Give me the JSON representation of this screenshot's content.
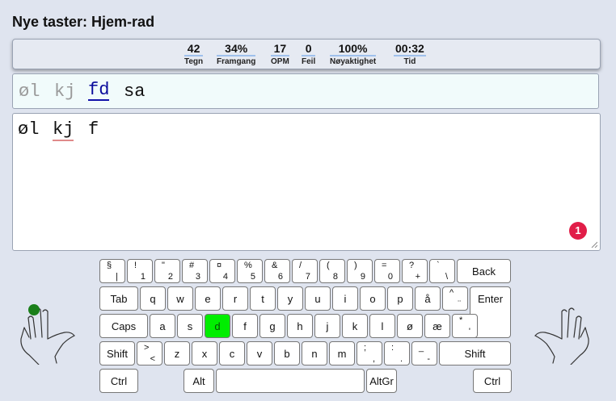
{
  "title": "Nye taster: Hjem-rad",
  "stats": [
    {
      "value": "42",
      "label": "Tegn"
    },
    {
      "value": "34%",
      "label": "Framgang"
    },
    {
      "value": "17",
      "label": "OPM"
    },
    {
      "value": "0",
      "label": "Feil"
    },
    {
      "value": "100%",
      "label": "Nøyaktighet"
    },
    {
      "value": "00:32",
      "label": "Tid"
    }
  ],
  "preview": {
    "typed1": "øl",
    "typed2": "kj",
    "current": "fd",
    "next": "sa"
  },
  "input": {
    "w1": "øl",
    "w2": "kj",
    "w3": "f"
  },
  "error_badge": "1",
  "keyboard": {
    "highlight_color": "#00ee00",
    "row1": [
      [
        "§",
        "|"
      ],
      [
        "!",
        "1"
      ],
      [
        "\"",
        "2"
      ],
      [
        "#",
        "3"
      ],
      [
        "¤",
        "4"
      ],
      [
        "%",
        "5"
      ],
      [
        "&",
        "6"
      ],
      [
        "/",
        "7"
      ],
      [
        "(",
        "8"
      ],
      [
        ")",
        "9"
      ],
      [
        "=",
        "0"
      ],
      [
        "?",
        "+"
      ],
      [
        "`",
        "\\"
      ]
    ],
    "back": "Back",
    "tab": "Tab",
    "row2": [
      "q",
      "w",
      "e",
      "r",
      "t",
      "y",
      "u",
      "i",
      "o",
      "p",
      "å"
    ],
    "row2_extra": [
      "^",
      "¨"
    ],
    "enter": "Enter",
    "caps": "Caps",
    "row3": [
      "a",
      "s",
      "d",
      "f",
      "g",
      "h",
      "j",
      "k",
      "l",
      "ø",
      "æ"
    ],
    "row3_extra": [
      "*",
      "'"
    ],
    "shift_left": "Shift",
    "shift_right": "Shift",
    "lt": [
      ">",
      "<"
    ],
    "row4": [
      "z",
      "x",
      "c",
      "v",
      "b",
      "n",
      "m"
    ],
    "row4_sym": [
      [
        ";",
        ","
      ],
      [
        ":",
        "."
      ],
      [
        "_",
        "-"
      ]
    ],
    "ctrl_left": "Ctrl",
    "alt": "Alt",
    "altgr": "AltGr",
    "ctrl_right": "Ctrl",
    "highlighted": "d"
  }
}
